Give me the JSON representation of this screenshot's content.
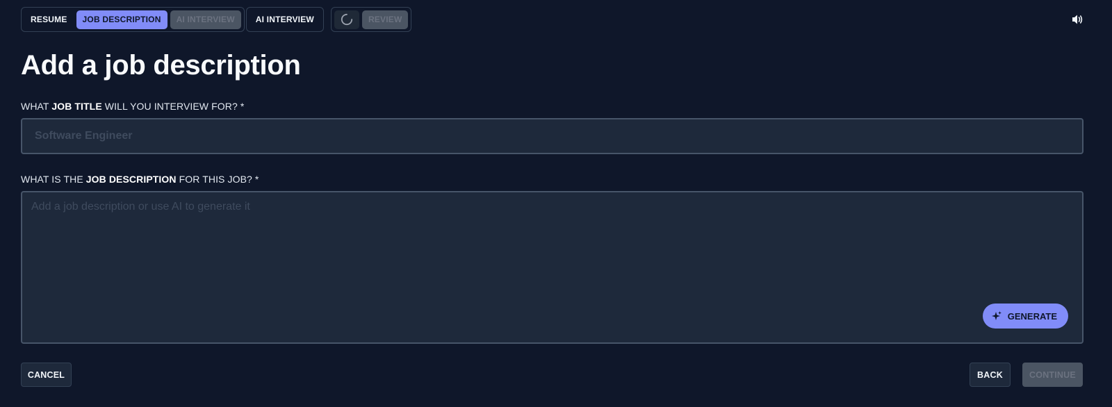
{
  "steps": {
    "resume": "RESUME",
    "job_description": "JOB DESCRIPTION",
    "ai_interview_disabled": "AI INTERVIEW",
    "ai_interview": "AI INTERVIEW",
    "review": "REVIEW"
  },
  "page": {
    "title": "Add a job description"
  },
  "job_title": {
    "label_prefix": "WHAT ",
    "label_bold": "JOB TITLE",
    "label_suffix": " WILL YOU INTERVIEW FOR? *",
    "placeholder": "Software Engineer",
    "value": ""
  },
  "job_description": {
    "label_prefix": "WHAT IS THE ",
    "label_bold": "JOB DESCRIPTION",
    "label_suffix": " FOR THIS JOB? *",
    "placeholder": "Add a job description or use AI to generate it",
    "value": "",
    "generate_label": "GENERATE"
  },
  "footer": {
    "cancel_label": "CANCEL",
    "back_label": "BACK",
    "continue_label": "CONTINUE"
  },
  "icons": {
    "sound": "speaker-icon",
    "spinner": "loading-spinner-icon",
    "generate": "sparkle-icon"
  },
  "colors": {
    "background": "#0f172a",
    "accent": "#818cf8",
    "input_bg": "#1e293b",
    "disabled": "#4b5563"
  }
}
